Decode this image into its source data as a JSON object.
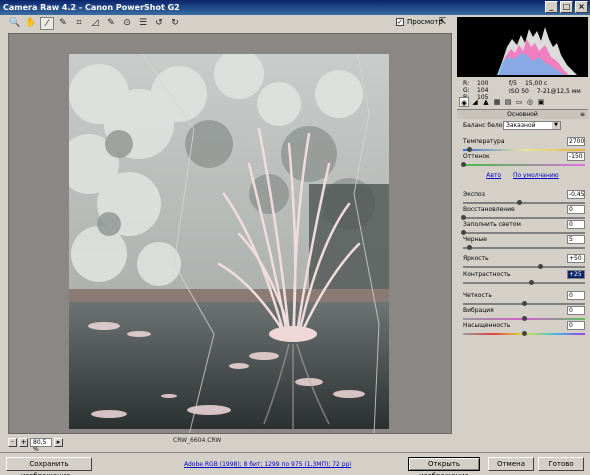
{
  "window": {
    "title": "Camera Raw 4.2  -  Canon PowerShot G2"
  },
  "toolbar": {
    "tools": [
      "zoom-icon",
      "hand-icon",
      "white-balance-icon",
      "color-sampler-icon",
      "crop-icon",
      "straighten-icon",
      "retouch-icon",
      "red-eye-icon",
      "preferences-icon",
      "rotate-left-icon",
      "rotate-right-icon"
    ],
    "preview_label": "Просмотр",
    "preview_checked": true
  },
  "preview": {
    "zoom_value": "80,5 %",
    "filename": "CRW_6604.CRW"
  },
  "info": {
    "r_label": "R:",
    "r": "100",
    "g_label": "G:",
    "g": "104",
    "b_label": "B:",
    "b": "105",
    "aperture": "f/5",
    "shutter": "15,00 с",
    "iso": "ISO 50",
    "focal": "7-21@12,5 мм"
  },
  "panel": {
    "section_title": "Основной",
    "wb_label": "Баланс белого:",
    "wb_value": "Заказной",
    "auto_link": "Авто",
    "default_link": "По умолчанию",
    "sliders": [
      {
        "label": "Температура",
        "value": "2700",
        "pos": 0.05
      },
      {
        "label": "Оттенок",
        "value": "-150",
        "pos": 0.0
      },
      {
        "label": "Экспоз",
        "value": "-0,45",
        "pos": 0.46
      },
      {
        "label": "Восстановление",
        "value": "0",
        "pos": 0.0
      },
      {
        "label": "Заполнить светом",
        "value": "0",
        "pos": 0.0
      },
      {
        "label": "Черные",
        "value": "5",
        "pos": 0.05
      },
      {
        "label": "Яркость",
        "value": "+50",
        "pos": 0.63
      },
      {
        "label": "Контрастность",
        "value": "+25",
        "pos": 0.56,
        "highlight": true
      },
      {
        "label": "Четкость",
        "value": "0",
        "pos": 0.5
      },
      {
        "label": "Вибрация",
        "value": "0",
        "pos": 0.5
      },
      {
        "label": "Насыщенность",
        "value": "0",
        "pos": 0.5
      }
    ]
  },
  "bottom": {
    "save_label": "Сохранить изображение...",
    "workflow_link": "Adobe RGB (1998); 8 бит; 1299 по 975 (1,3МП); 72 ppi",
    "open_label": "Открыть изображение",
    "cancel_label": "Отмена",
    "done_label": "Готово"
  }
}
